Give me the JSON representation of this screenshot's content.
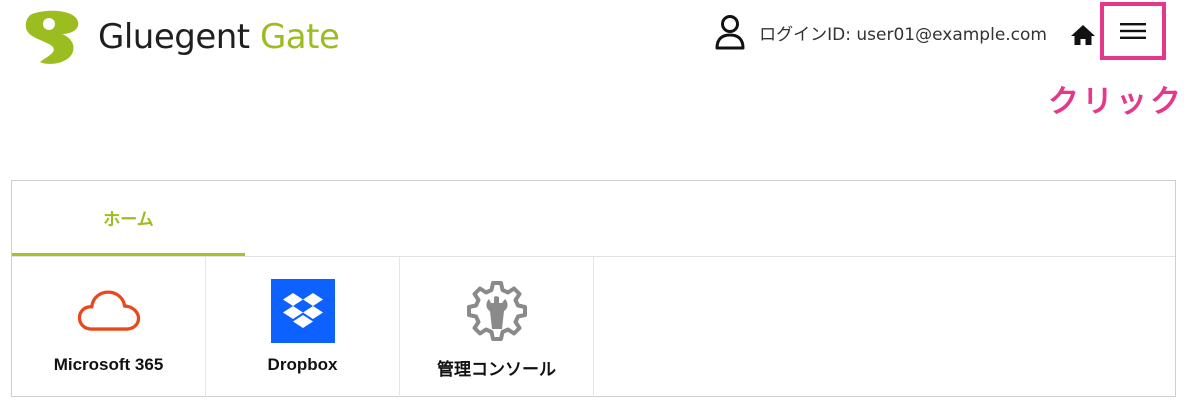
{
  "header": {
    "logo": {
      "word1": "Gluegent",
      "word2": "Gate"
    },
    "login_text": "ログインID: user01@example.com",
    "home_icon": "home-icon",
    "menu_icon": "hamburger-menu-icon"
  },
  "annotation": {
    "click_label": "クリック",
    "color": "#e5388a"
  },
  "tabs": [
    {
      "label": "ホーム",
      "active": true
    }
  ],
  "apps": [
    {
      "label": "Microsoft 365",
      "icon": "cloud-icon",
      "color": "#e8481c"
    },
    {
      "label": "Dropbox",
      "icon": "dropbox-icon",
      "color": "#0d61fe"
    },
    {
      "label": "管理コンソール",
      "icon": "gear-wrench-icon",
      "color": "#8a8a8a"
    }
  ],
  "colors": {
    "brand_green": "#9bbd1f",
    "accent_pink": "#e5388a"
  }
}
